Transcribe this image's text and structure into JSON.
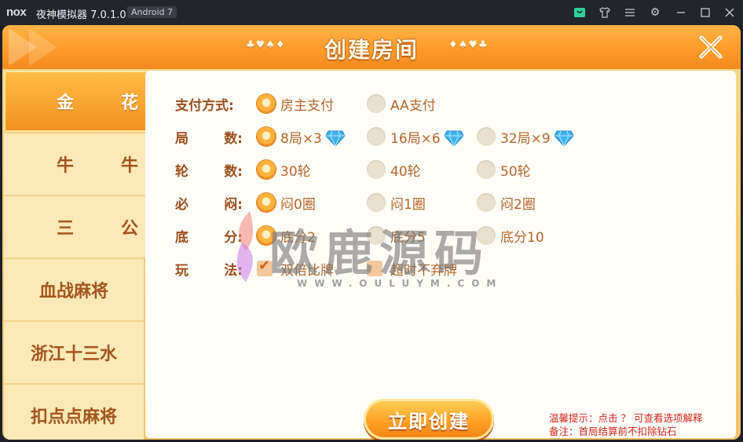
{
  "window": {
    "logo": "nox",
    "title": "夜神模拟器 7.0.1.0",
    "android_badge": "Android 7",
    "icons": [
      "store-icon",
      "shirt-icon",
      "menu-icon",
      "gear-icon",
      "minimize-icon",
      "maximize-icon",
      "close-icon"
    ]
  },
  "header": {
    "title": "创建房间",
    "suits_left": "♣♥♠♦",
    "suits_right": "♦♠♥♣"
  },
  "sidebar": {
    "items": [
      {
        "label": "金花",
        "active": true
      },
      {
        "label": "牛牛",
        "active": false
      },
      {
        "label": "三公",
        "active": false
      },
      {
        "label": "血战麻将",
        "active": false
      },
      {
        "label": "浙江十三水",
        "active": false
      },
      {
        "label": "扣点点麻将",
        "active": false
      }
    ]
  },
  "form": {
    "payment": {
      "label": "支付方式:",
      "options": [
        {
          "text": "房主支付",
          "selected": true
        },
        {
          "text": "AA支付",
          "selected": false
        }
      ]
    },
    "rounds": {
      "label_a": "局",
      "label_b": "数:",
      "options": [
        {
          "text": "8局×3",
          "selected": true,
          "gem": true
        },
        {
          "text": "16局×6",
          "selected": false,
          "gem": true
        },
        {
          "text": "32局×9",
          "selected": false,
          "gem": true
        }
      ]
    },
    "turns": {
      "label_a": "轮",
      "label_b": "数:",
      "options": [
        {
          "text": "30轮",
          "selected": true
        },
        {
          "text": "40轮",
          "selected": false
        },
        {
          "text": "50轮",
          "selected": false
        }
      ]
    },
    "must_blind": {
      "label_a": "必",
      "label_b": "闷:",
      "options": [
        {
          "text": "闷0圈",
          "selected": true
        },
        {
          "text": "闷1圈",
          "selected": false
        },
        {
          "text": "闷2圈",
          "selected": false
        }
      ]
    },
    "base_score": {
      "label_a": "底",
      "label_b": "分:",
      "options": [
        {
          "text": "底分2",
          "selected": true
        },
        {
          "text": "底分5",
          "selected": false
        },
        {
          "text": "底分10",
          "selected": false
        }
      ]
    },
    "play": {
      "label_a": "玩",
      "label_b": "法:",
      "options": [
        {
          "text": "双倍比牌",
          "checked": true
        },
        {
          "text": "超时不弃牌",
          "checked": false
        }
      ]
    }
  },
  "create_button": "立即创建",
  "tips": {
    "line1": "温馨提示：点击 ？ 可查看选项解释",
    "line2": "备注：首局结算前不扣除钻石"
  },
  "watermark": {
    "main": "欧鹿源码",
    "sub": "WWW.OULUYM.COM"
  },
  "colors": {
    "accent": "#ff9b2a",
    "label": "#9c4e1d",
    "tip": "#d2261f"
  }
}
